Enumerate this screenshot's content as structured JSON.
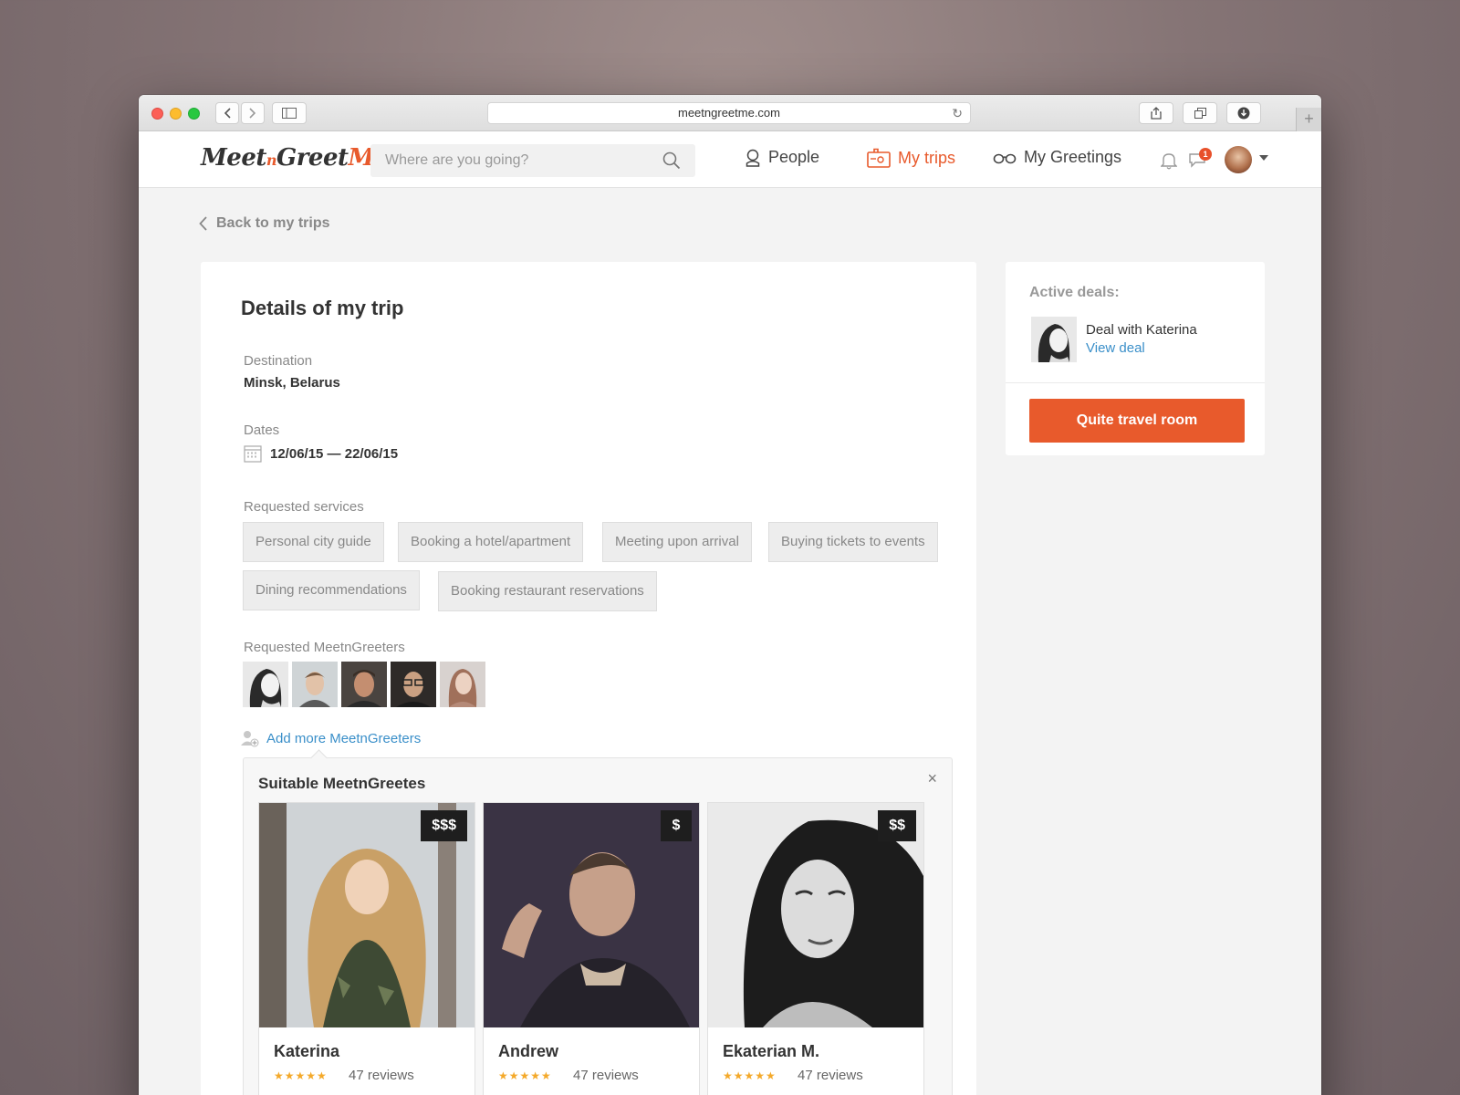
{
  "browser": {
    "url": "meetngreetme.com",
    "new_tab_symbol": "+"
  },
  "header": {
    "logo": {
      "part1": "Meet",
      "part2": "n",
      "part3": "Greet",
      "part4": "Me"
    },
    "search_placeholder": "Where are you going?",
    "nav": {
      "people": "People",
      "my_trips": "My trips",
      "my_greetings": "My Greetings"
    },
    "messages_badge": "1",
    "accent_color": "#e85a2c"
  },
  "page": {
    "back_link": "Back to my trips",
    "title": "Details of my trip",
    "destination_label": "Destination",
    "destination_value": "Minsk, Belarus",
    "dates_label": "Dates",
    "dates_value": "12/06/15 — 22/06/15",
    "services_label": "Requested services",
    "services": [
      "Personal city guide",
      "Booking a hotel/apartment",
      "Meeting upon arrival",
      "Buying tickets to events",
      "Dining recommendations",
      "Booking restaurant reservations"
    ],
    "greeters_label": "Requested MeetnGreeters",
    "add_more": "Add more MeetnGreeters",
    "suitable": {
      "title": "Suitable MeetnGreetes",
      "close": "×",
      "people": [
        {
          "name": "Katerina",
          "price": "$$$",
          "stars": "★★★★★",
          "reviews": "47 reviews"
        },
        {
          "name": "Andrew",
          "price": "$",
          "stars": "★★★★★",
          "reviews": "47 reviews"
        },
        {
          "name": "Ekaterian M.",
          "price": "$$",
          "stars": "★★★★★",
          "reviews": "47 reviews"
        }
      ]
    }
  },
  "side": {
    "active_deals_label": "Active deals:",
    "deal_name": "Deal with Katerina",
    "view_deal": "View deal",
    "quit_button": "Quite travel room"
  }
}
